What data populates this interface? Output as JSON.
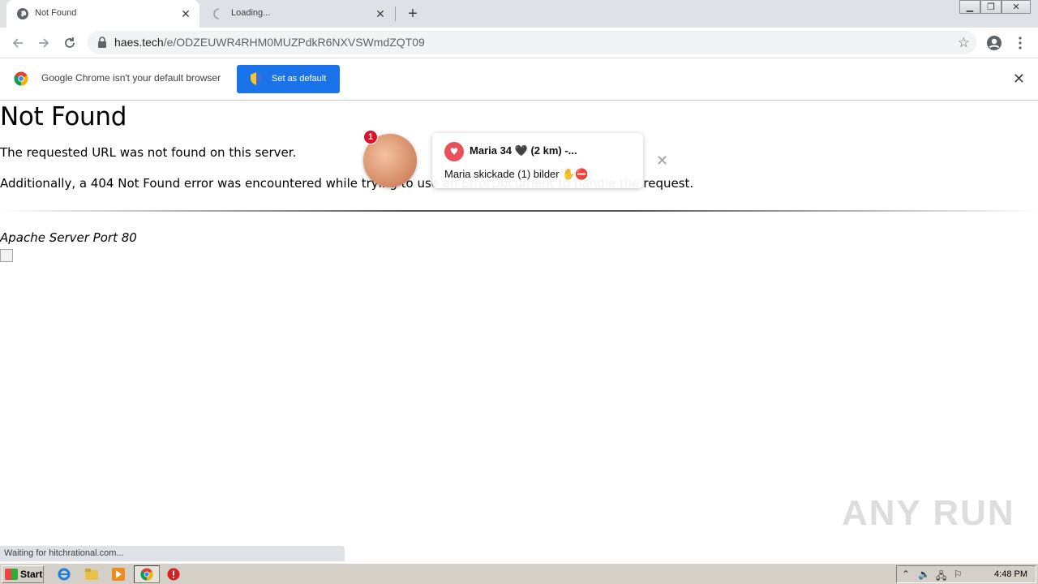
{
  "browser": {
    "tabs": [
      {
        "title": "Not Found",
        "active": true
      },
      {
        "title": "Loading...",
        "active": false
      }
    ],
    "url_host": "haes.tech",
    "url_path": "/e/ODZEUWR4RHM0MUZPdkR6NXVSWmdZQT09"
  },
  "infobar": {
    "message": "Google Chrome isn't your default browser",
    "button_label": "Set as default"
  },
  "page": {
    "heading": "Not Found",
    "paragraph1": "The requested URL was not found on this server.",
    "paragraph2": "Additionally, a 404 Not Found error was encountered while trying to use an ErrorDocument to handle the request.",
    "address": "Apache Server Port 80"
  },
  "notification": {
    "badge_count": "1",
    "title": "Maria 34 🖤 (2 km) -...",
    "body": "Maria skickade (1) bilder ✋⛔"
  },
  "status_text": "Waiting for hitchrational.com...",
  "watermark": "ANY RUN",
  "taskbar": {
    "start_label": "Start",
    "clock": "4:48 PM"
  },
  "colors": {
    "accent": "#1a73e8",
    "badge": "#e0102a",
    "heart": "#e8505b"
  }
}
